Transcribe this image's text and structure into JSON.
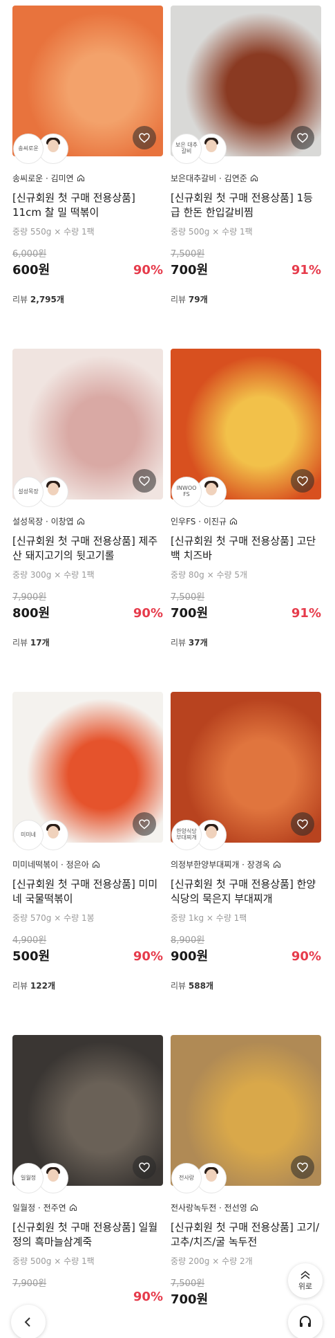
{
  "products": [
    {
      "seller": "송씨로운 · 김미연",
      "brand_short": "송씨로운",
      "title": "[신규회원 첫 구매 전용상품] 11cm 찰 밀 떡볶이",
      "spec": "중량 550g × 수량 1팩",
      "original_price": "6,000원",
      "price": "600원",
      "discount": "90%",
      "review_label": "리뷰",
      "review_count": "2,795개",
      "colors": {
        "photo_a": "#e8733d",
        "photo_b": "#f3a26b"
      }
    },
    {
      "seller": "보은대추갈비 · 김연준",
      "brand_short": "보은 대추 갈비",
      "title": "[신규회원 첫 구매 전용상품] 1등급 한돈 한입갈비찜",
      "spec": "중량 500g × 수량 1팩",
      "original_price": "7,500원",
      "price": "700원",
      "discount": "91%",
      "review_label": "리뷰",
      "review_count": "79개",
      "colors": {
        "photo_a": "#d9d9d7",
        "photo_b": "#8a3a22"
      }
    },
    {
      "seller": "설성목장 · 이창엽",
      "brand_short": "설성목장",
      "title": "[신규회원 첫 구매 전용상품] 제주산 돼지고기의 뒷고기롤",
      "spec": "중량 300g × 수량 1팩",
      "original_price": "7,900원",
      "price": "800원",
      "discount": "90%",
      "review_label": "리뷰",
      "review_count": "17개",
      "colors": {
        "photo_a": "#f0e4e0",
        "photo_b": "#d9a9a4"
      }
    },
    {
      "seller": "인우FS · 이진규",
      "brand_short": "INWOO FS",
      "title": "[신규회원 첫 구매 전용상품] 고단백 치즈바",
      "spec": "중량 80g × 수량 5개",
      "original_price": "7,500원",
      "price": "700원",
      "discount": "91%",
      "review_label": "리뷰",
      "review_count": "37개",
      "colors": {
        "photo_a": "#d8501f",
        "photo_b": "#f2c14a"
      }
    },
    {
      "seller": "미미네떡볶이 · 정은아",
      "brand_short": "미미네",
      "title": "[신규회원 첫 구매 전용상품] 미미네 국물떡볶이",
      "spec": "중량 570g × 수량 1봉",
      "original_price": "4,900원",
      "price": "500원",
      "discount": "90%",
      "review_label": "리뷰",
      "review_count": "122개",
      "colors": {
        "photo_a": "#f4f2ee",
        "photo_b": "#e5532c"
      }
    },
    {
      "seller": "의정부한양부대찌개 · 장경옥",
      "brand_short": "한양식당 부대찌개",
      "title": "[신규회원 첫 구매 전용상품] 한양식당의 묵은지 부대찌개",
      "spec": "중량 1kg × 수량 1팩",
      "original_price": "8,900원",
      "price": "900원",
      "discount": "90%",
      "review_label": "리뷰",
      "review_count": "588개",
      "colors": {
        "photo_a": "#b8431f",
        "photo_b": "#e0753e"
      }
    },
    {
      "seller": "일월정 · 전주연",
      "brand_short": "일월정",
      "title": "[신규회원 첫 구매 전용상품] 일월정의 흑마늘삼계죽",
      "spec": "중량 500g × 수량 1팩",
      "original_price": "7,900원",
      "price": "",
      "discount": "90%",
      "review_label": "",
      "review_count": "",
      "colors": {
        "photo_a": "#3a3633",
        "photo_b": "#6a6157"
      }
    },
    {
      "seller": "전사랑녹두전 · 전선영",
      "brand_short": "전사랑",
      "title": "[신규회원 첫 구매 전용상품] 고기/고추/치즈/굴 녹두전",
      "spec": "중량 200g × 수량 2개",
      "original_price": "7,500원",
      "price": "700원",
      "discount": "",
      "review_label": "",
      "review_count": "",
      "colors": {
        "photo_a": "#b08a55",
        "photo_b": "#d9a84a"
      }
    }
  ],
  "floating": {
    "top_label": "위로",
    "top_icon": "double-chevron-up-icon",
    "cs_icon": "headset-icon",
    "back_icon": "chevron-left-icon"
  },
  "accent": "#e63b4b"
}
